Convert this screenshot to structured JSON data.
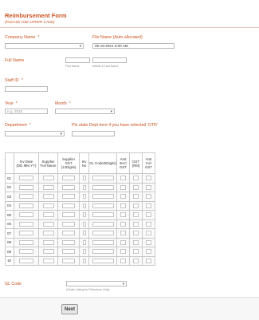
{
  "form": {
    "title": "Reimbursement Form",
    "subtitle": "(PLEASE USE UPPER CASE)"
  },
  "fields": {
    "company_name": {
      "label": "Company Name",
      "required": "*"
    },
    "file_name": {
      "label": "File Name (Auto allocated)",
      "value": "05-18-2021 5:00 AM"
    },
    "full_name": {
      "label": "Full Name",
      "first_sub": "First Name",
      "last_sub": "Middle & Last Name"
    },
    "staff_id": {
      "label": "Staff ID",
      "required": "*"
    },
    "year": {
      "label": "Year",
      "required": "*",
      "placeholder": "e.g. 2015"
    },
    "month": {
      "label": "Month",
      "required": "*"
    },
    "department": {
      "label": "Department",
      "required": "*"
    },
    "other_dept": {
      "label": "Pls state Dept here if you have selected 'OTR'"
    },
    "gl_code": {
      "label": "GL Code",
      "sub": "(Guide Listing for Reference Only)"
    }
  },
  "table": {
    "headers": [
      "",
      "Inv Date (DD.MM.YY)",
      "Supplier Full Name",
      "Supplier GST (12Digits)",
      "Inv No",
      "GL Code(5Digits)",
      "Amt Excl GST",
      "GST (RM)",
      "Amt Incl GST"
    ],
    "rows": [
      "01",
      "02",
      "03",
      "04",
      "05",
      "06",
      "07",
      "08",
      "09",
      "10"
    ]
  },
  "buttons": {
    "next": "Next"
  }
}
